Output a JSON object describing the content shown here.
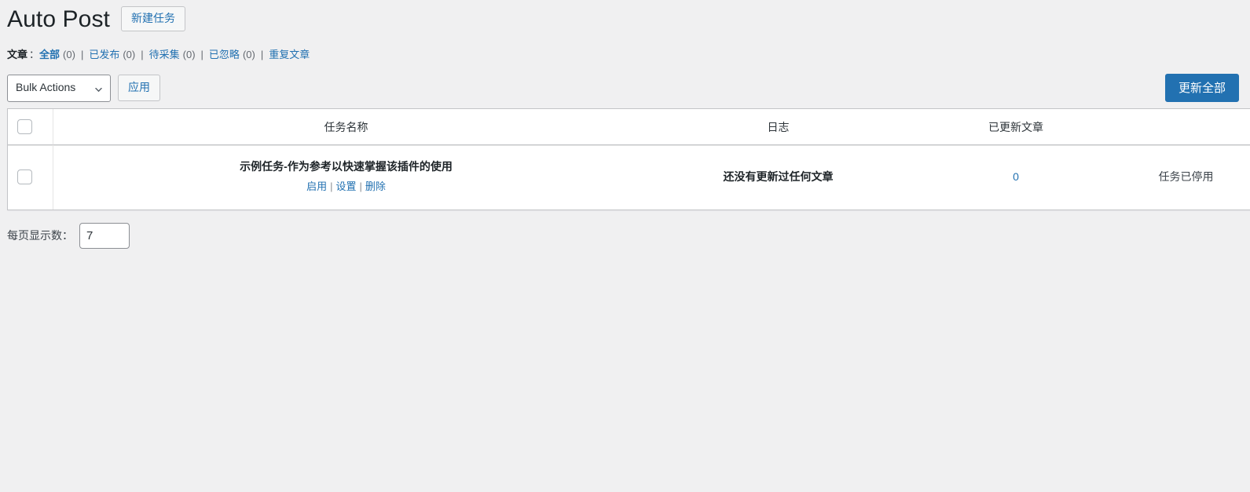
{
  "header": {
    "title": "Auto Post",
    "action_button": "新建任务"
  },
  "filters": {
    "group_label": "文章",
    "colon": "：",
    "separator": "|",
    "items": [
      {
        "label": "全部",
        "count": "(0)",
        "current": true
      },
      {
        "label": "已发布",
        "count": "(0)",
        "current": false
      },
      {
        "label": "待采集",
        "count": "(0)",
        "current": false
      },
      {
        "label": "已忽略",
        "count": "(0)",
        "current": false
      },
      {
        "label": "重复文章",
        "count": "",
        "current": false
      }
    ]
  },
  "toolbar": {
    "bulk_actions_label": "Bulk Actions",
    "bulk_actions_options": [
      "Bulk Actions"
    ],
    "apply_label": "应用",
    "update_all_label": "更新全部",
    "chevron_icon": "chevron-down-icon"
  },
  "table": {
    "select_all_name": "select-all-checkbox",
    "columns": [
      {
        "key": "cb",
        "label": ""
      },
      {
        "key": "name",
        "label": "任务名称"
      },
      {
        "key": "log",
        "label": "日志"
      },
      {
        "key": "count",
        "label": "已更新文章"
      },
      {
        "key": "status",
        "label": ""
      }
    ],
    "rows": [
      {
        "name": "示例任务-作为参考以快速掌握该插件的使用",
        "actions": [
          {
            "label": "启用"
          },
          {
            "label": "设置"
          },
          {
            "label": "删除"
          }
        ],
        "action_divider": "|",
        "log": "还没有更新过任何文章",
        "count": "0",
        "status": "任务已停用"
      }
    ]
  },
  "footer": {
    "per_page_label": "每页显示数：",
    "per_page_value": "7"
  },
  "colors": {
    "page_background": "#f0f0f1",
    "link": "#2271b1",
    "primary_button": "#2271b1",
    "title": "#1d2327",
    "border": "#c3c4c7"
  }
}
